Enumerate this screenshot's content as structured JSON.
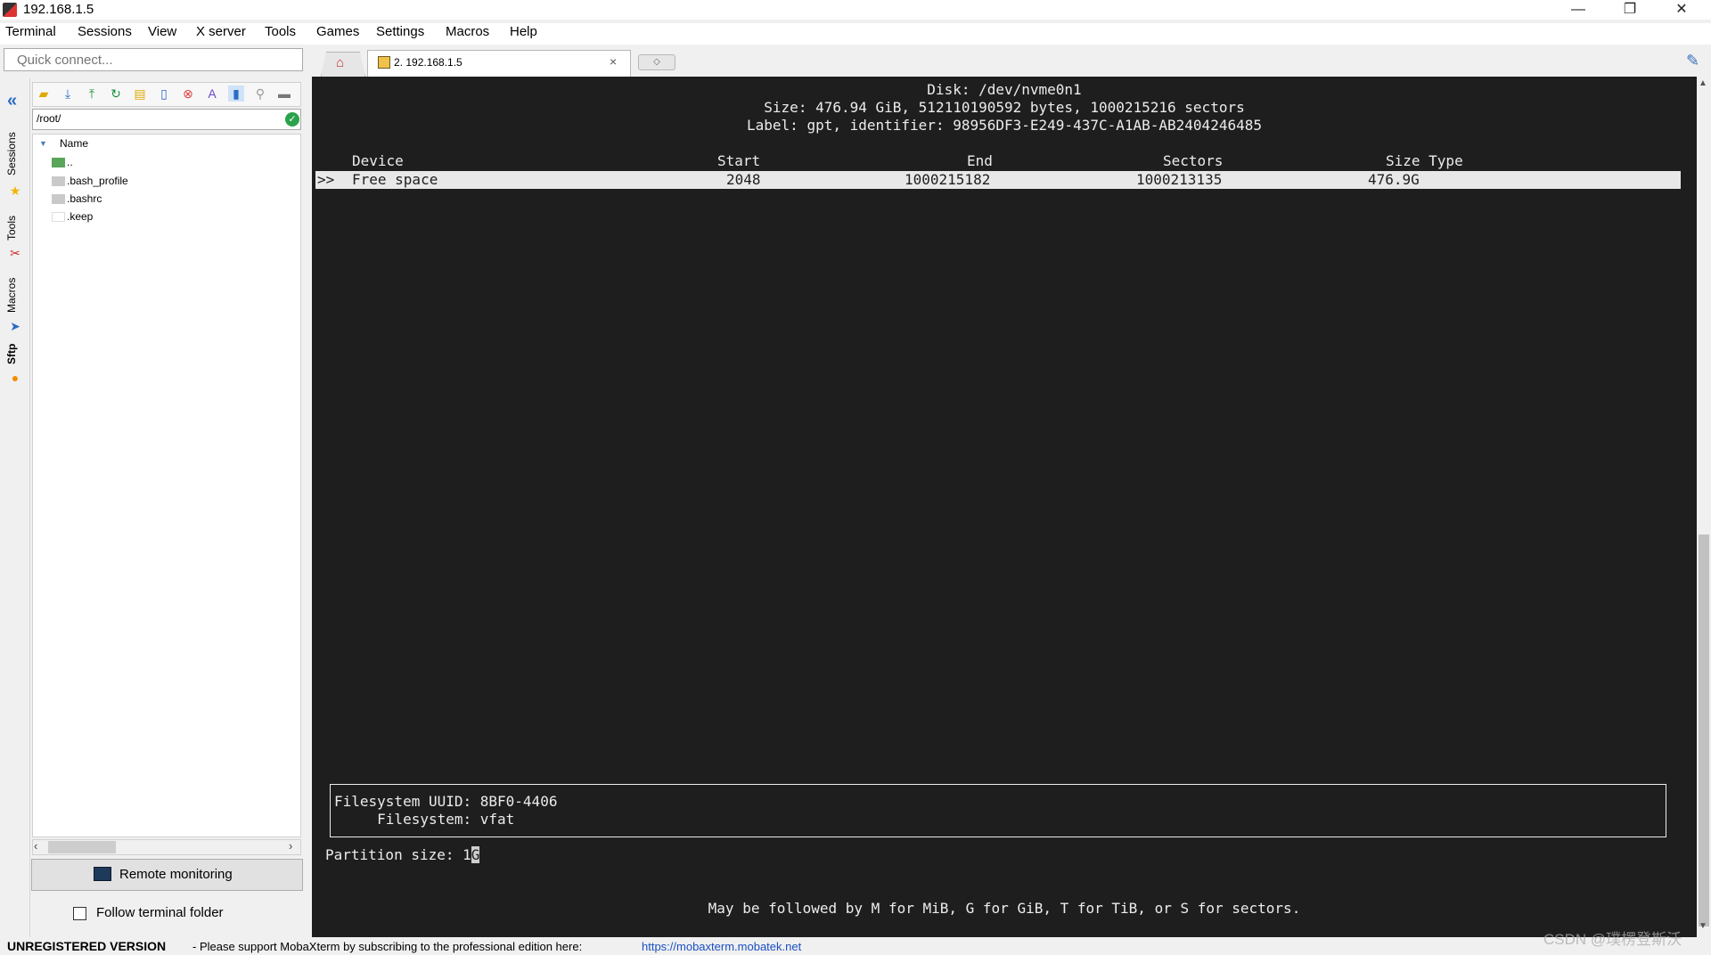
{
  "window": {
    "title": "192.168.1.5",
    "minimize": "—",
    "restore": "❐",
    "close": "✕"
  },
  "menu": [
    "Terminal",
    "Sessions",
    "View",
    "X server",
    "Tools",
    "Games",
    "Settings",
    "Macros",
    "Help"
  ],
  "quick_connect": {
    "placeholder": "Quick connect..."
  },
  "tabs": {
    "session_label": "2. 192.168.1.5",
    "close": "×"
  },
  "sidebar": {
    "tabs": [
      "Sessions",
      "Tools",
      "Macros",
      "Sftp"
    ]
  },
  "file_browser": {
    "path": "/root/",
    "column_header": "Name",
    "files": [
      "..",
      ".bash_profile",
      ".bashrc",
      ".keep"
    ],
    "remote_monitoring": "Remote monitoring",
    "follow_terminal_folder": "Follow terminal folder"
  },
  "terminal": {
    "disk_line": "Disk: /dev/nvme0n1",
    "size_line": "Size: 476.94 GiB, 512110190592 bytes, 1000215216 sectors",
    "label_line": "Label: gpt, identifier: 98956DF3-E249-437C-A1AB-AB2404246485",
    "headers": {
      "device": "Device",
      "start": "Start",
      "end": "End",
      "sectors": "Sectors",
      "size_type": "Size Type"
    },
    "row": {
      "marker": ">>",
      "device": "Free space",
      "start": "2048",
      "end": "1000215182",
      "sectors": "1000213135",
      "size": "476.9G"
    },
    "fs_uuid_line": "Filesystem UUID: 8BF0-4406",
    "fs_line": "     Filesystem: vfat",
    "prompt": "Partition size: ",
    "input_value": "1",
    "cursor_char": "G",
    "hint": "May be followed by M for MiB, G for GiB, T for TiB, or S for sectors."
  },
  "status": {
    "unregistered": "UNREGISTERED VERSION",
    "message": "-  Please support MobaXterm by subscribing to the professional edition here:",
    "link": "https://mobaxterm.mobatek.net"
  },
  "watermark": "CSDN @璞楞登斯沃"
}
